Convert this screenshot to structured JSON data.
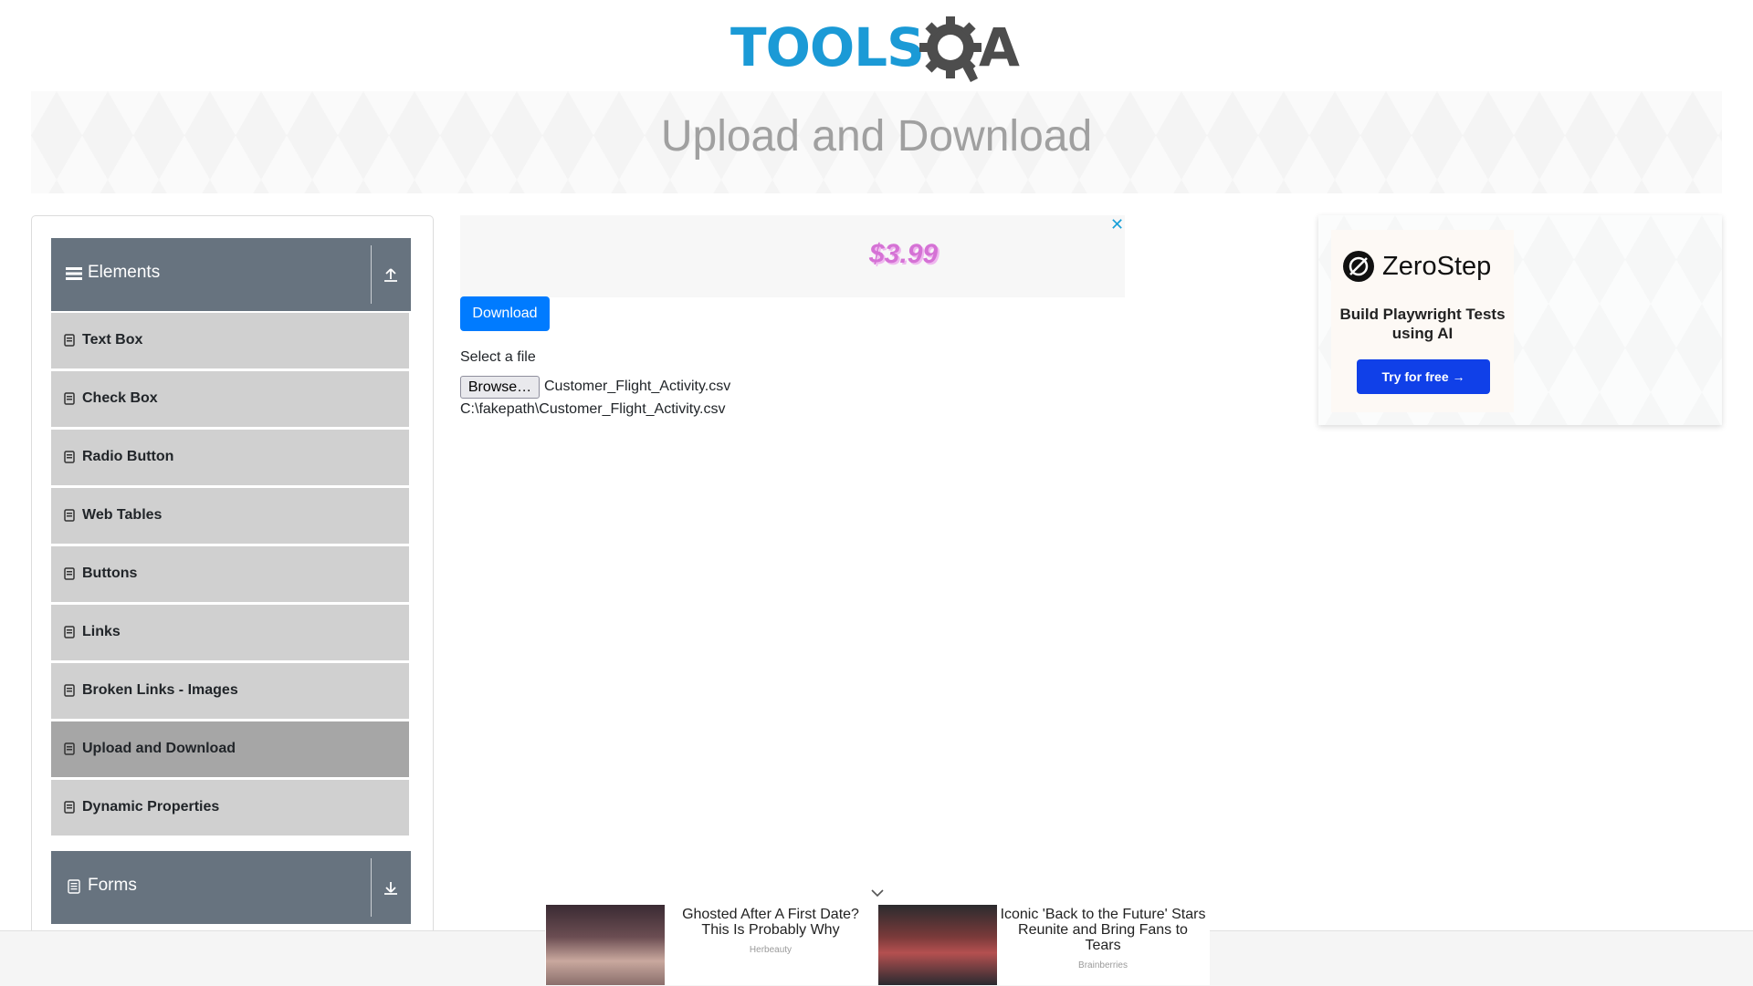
{
  "header": {
    "logo_text_left": "TOOLS",
    "logo_text_right": "A"
  },
  "banner": {
    "title": "Upload and Download"
  },
  "sidebar": {
    "elements_group": {
      "label": "Elements",
      "toggle_icon": "collapse-up-icon"
    },
    "items": [
      {
        "label": "Text Box"
      },
      {
        "label": "Check Box"
      },
      {
        "label": "Radio Button"
      },
      {
        "label": "Web Tables"
      },
      {
        "label": "Buttons"
      },
      {
        "label": "Links"
      },
      {
        "label": "Broken Links - Images"
      },
      {
        "label": "Upload and Download",
        "active": true
      },
      {
        "label": "Dynamic Properties"
      }
    ],
    "forms_group": {
      "label": "Forms",
      "toggle_icon": "expand-down-icon"
    }
  },
  "main": {
    "ad": {
      "price": "$3.99",
      "close": "✕"
    },
    "download_label": "Download",
    "select_label": "Select a file",
    "browse_label": "Browse…",
    "selected_file": "Customer_Flight_Activity.csv",
    "uploaded_path": "C:\\fakepath\\Customer_Flight_Activity.csv"
  },
  "right_ad": {
    "brand": "ZeroStep",
    "tagline": "Build Playwright Tests using AI",
    "cta": "Try for free →"
  },
  "bottom_ad": {
    "items": [
      {
        "title": "Ghosted After A First Date? This Is Probably Why",
        "source": "Herbeauty"
      },
      {
        "title": "Iconic 'Back to the Future' Stars Reunite and Bring Fans to Tears",
        "source": "Brainberries"
      }
    ]
  },
  "colors": {
    "accent": "#007bff",
    "sidebar_header": "#67737f",
    "menu_item": "#d0d0d0",
    "menu_item_active": "#a6a6a6",
    "logo_blue": "#1b9ad6",
    "zerostep_blue": "#1040e8"
  }
}
